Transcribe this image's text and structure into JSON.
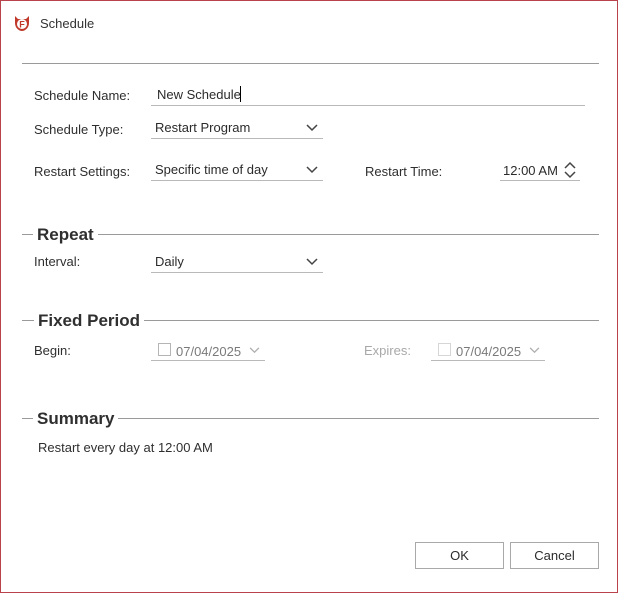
{
  "window": {
    "title": "Schedule",
    "app_icon": "app-logo-icon"
  },
  "form": {
    "name": {
      "label": "Schedule Name:",
      "value": "New Schedule"
    },
    "type": {
      "label": "Schedule Type:",
      "value": "Restart Program"
    },
    "restart_settings": {
      "label": "Restart Settings:",
      "value": "Specific time of day"
    },
    "restart_time": {
      "label": "Restart Time:",
      "value": "12:00 AM"
    }
  },
  "repeat": {
    "title": "Repeat",
    "interval": {
      "label": "Interval:",
      "value": "Daily"
    }
  },
  "fixed_period": {
    "title": "Fixed Period",
    "begin": {
      "label": "Begin:",
      "value": "07/04/2025",
      "checked": false
    },
    "expires": {
      "label": "Expires:",
      "value": "07/04/2025",
      "checked": false,
      "disabled": true
    }
  },
  "summary": {
    "title": "Summary",
    "text": "Restart every day at 12:00 AM"
  },
  "buttons": {
    "ok": "OK",
    "cancel": "Cancel"
  },
  "colors": {
    "accent": "#b8434a",
    "app_icon": "#c0392b"
  }
}
